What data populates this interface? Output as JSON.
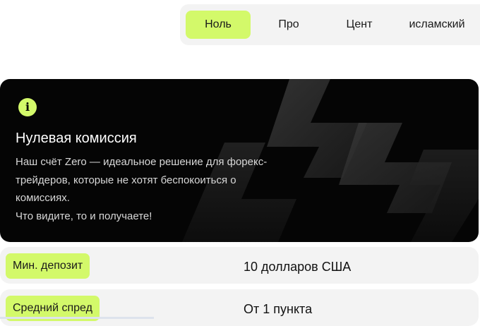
{
  "account_tabs": [
    {
      "label": "Ноль",
      "active": true
    },
    {
      "label": "Про",
      "active": false
    },
    {
      "label": "Цент",
      "active": false
    },
    {
      "label": "исламский",
      "active": false
    }
  ],
  "info_card": {
    "icon": "info-icon",
    "icon_glyph": "i",
    "title": "Нулевая комиссия",
    "lines": [
      "Наш счёт Zero — идеальное решение для форекс-",
      "трейдеров, которые не хотят беспокоиться о",
      "комиссиях.",
      "Что видите, то и получаете!"
    ]
  },
  "specs": [
    {
      "label": "Мин. депозит",
      "value": "10 долларов США"
    },
    {
      "label": "Средний спред",
      "value": "От 1 пункта"
    }
  ],
  "colors": {
    "accent": "#d3f96a",
    "card_background": "#050505",
    "row_background": "#f3f3f3"
  }
}
